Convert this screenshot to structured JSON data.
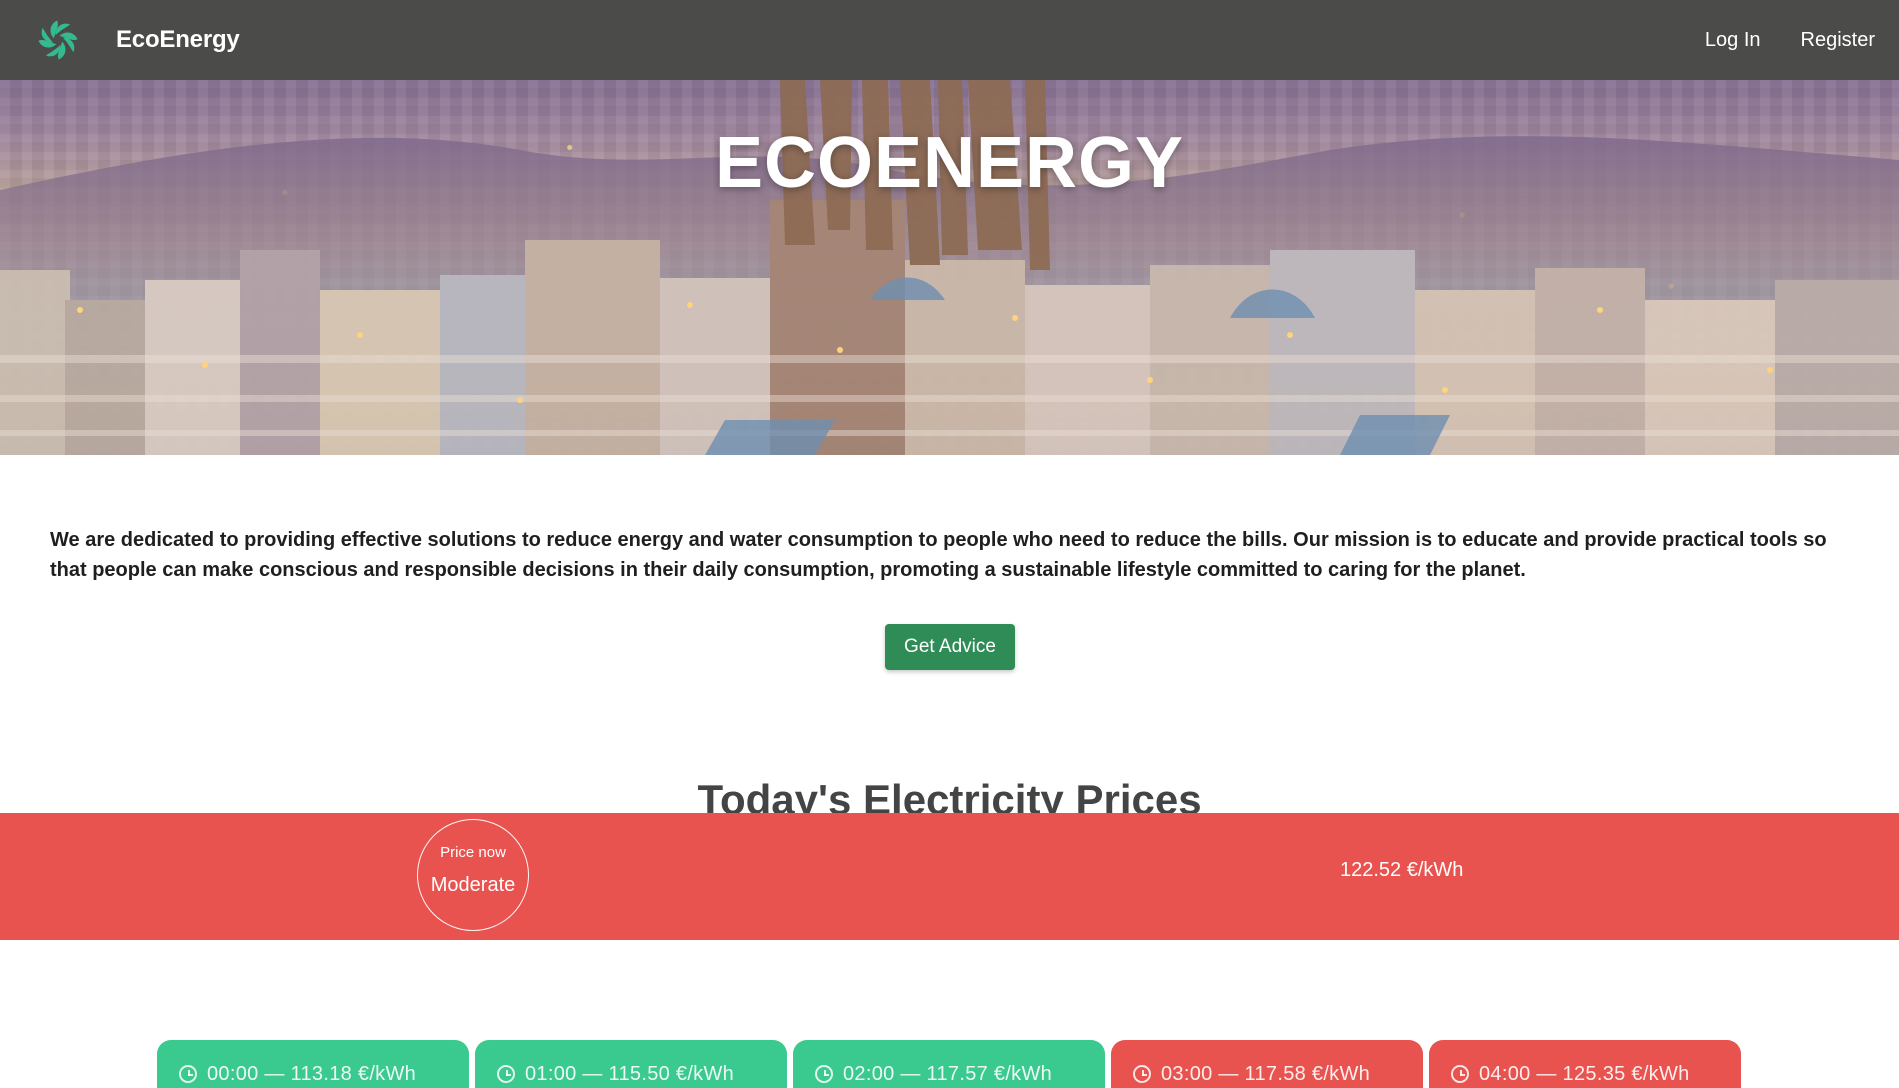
{
  "navbar": {
    "brand": "EcoEnergy",
    "logo_icon": "leaf-logo-icon",
    "links": {
      "login": "Log In",
      "register": "Register"
    }
  },
  "hero": {
    "title": "ECOENERGY"
  },
  "intro": {
    "text": "We are dedicated to providing effective solutions to reduce energy and water consumption to people who need to reduce the bills. Our mission is to educate and provide practical tools so that people can make conscious and responsible decisions in their daily consumption, promoting a sustainable lifestyle committed to caring for the planet."
  },
  "cta": {
    "advice_label": "Get Advice"
  },
  "prices": {
    "section_title": "Today's Electricity Prices",
    "current": {
      "label": "Price now",
      "level": "Moderate",
      "value": "122.52 €/kWh",
      "color": "#e9534f"
    },
    "hours": [
      {
        "text": "00:00 — 113.18 €/kWh",
        "status_color": "#3ac98e",
        "icon": "clock-icon"
      },
      {
        "text": "01:00 — 115.50 €/kWh",
        "status_color": "#3ac98e",
        "icon": "clock-icon"
      },
      {
        "text": "02:00 — 117.57 €/kWh",
        "status_color": "#3ac98e",
        "icon": "clock-icon"
      },
      {
        "text": "03:00 — 117.58 €/kWh",
        "status_color": "#e9534f",
        "icon": "clock-icon"
      },
      {
        "text": "04:00 — 125.35 €/kWh",
        "status_color": "#e9534f",
        "icon": "clock-icon"
      }
    ]
  }
}
